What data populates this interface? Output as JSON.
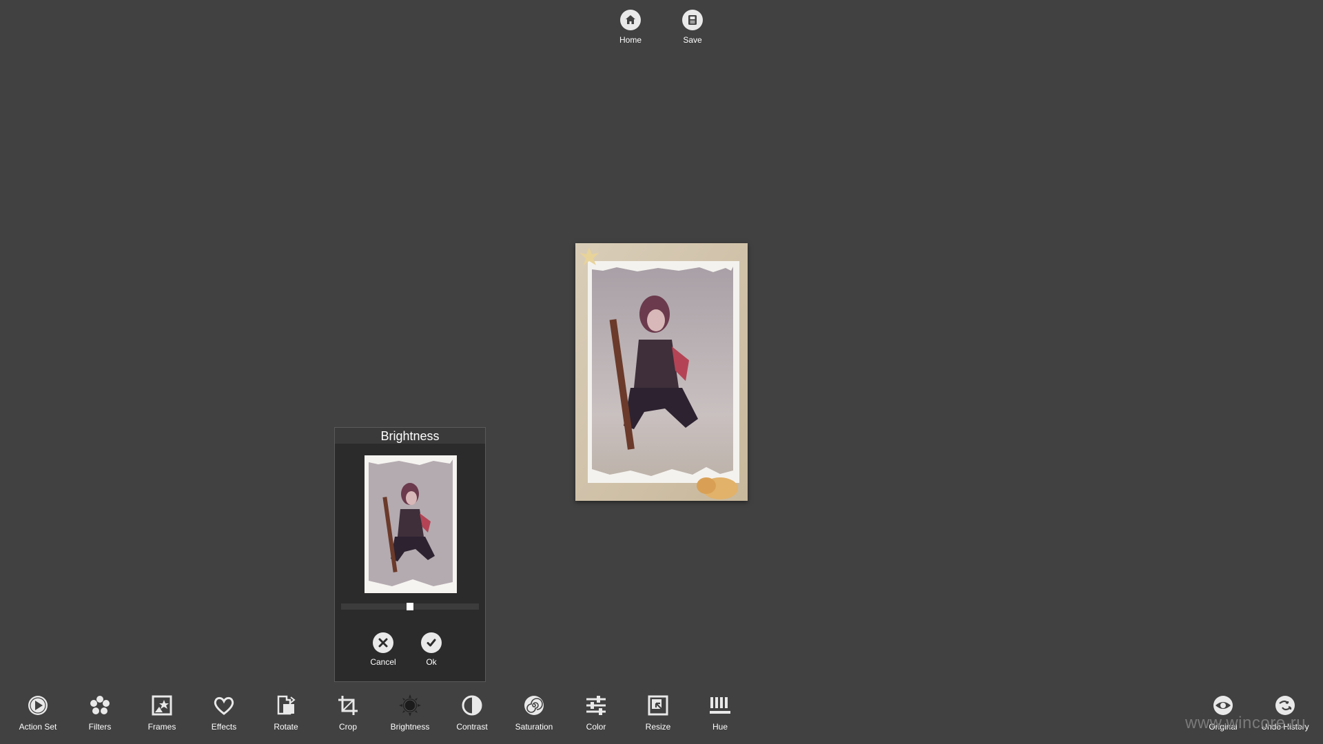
{
  "topbar": {
    "home_label": "Home",
    "save_label": "Save"
  },
  "brightness_panel": {
    "title": "Brightness",
    "slider_value_fraction": 0.5,
    "cancel_label": "Cancel",
    "ok_label": "Ok"
  },
  "toolbar": {
    "items": [
      {
        "label": "Action Set",
        "icon": "play-circle-icon"
      },
      {
        "label": "Filters",
        "icon": "flower-icon"
      },
      {
        "label": "Frames",
        "icon": "frame-star-icon"
      },
      {
        "label": "Effects",
        "icon": "heart-icon"
      },
      {
        "label": "Rotate",
        "icon": "rotate-icon"
      },
      {
        "label": "Crop",
        "icon": "crop-icon"
      },
      {
        "label": "Brightness",
        "icon": "sun-icon"
      },
      {
        "label": "Contrast",
        "icon": "contrast-icon"
      },
      {
        "label": "Saturation",
        "icon": "spiral-icon"
      },
      {
        "label": "Color",
        "icon": "sliders-icon"
      },
      {
        "label": "Resize",
        "icon": "resize-icon"
      },
      {
        "label": "Hue",
        "icon": "hue-bars-icon"
      }
    ],
    "right_items": [
      {
        "label": "Original",
        "icon": "eye-icon"
      },
      {
        "label": "Undo History",
        "icon": "undo-history-icon"
      }
    ]
  },
  "watermark": "www.wincore.ru",
  "colors": {
    "background": "#414141",
    "panel": "#2b2b2b",
    "icon_fill": "#e9e9e9"
  }
}
